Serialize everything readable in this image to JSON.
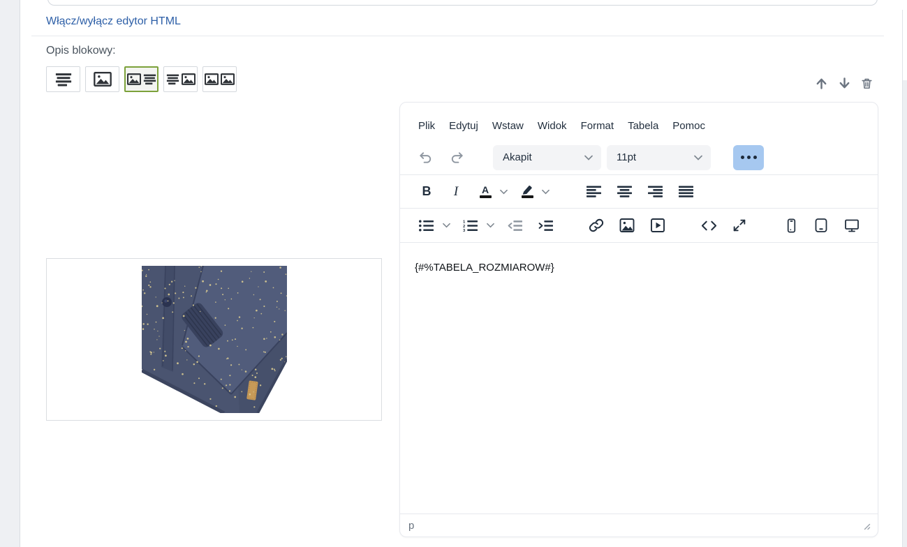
{
  "page": {
    "html_toggle_link": "Włącz/wyłącz edytor HTML",
    "block_label": "Opis blokowy:"
  },
  "colors": {
    "link_blue": "#2d5fa7",
    "selected_layout_green": "#7ca13a",
    "more_button_blue": "#a6c8f0",
    "toolbar_icon": "#222f3e",
    "jacket_navy": "#4a5470",
    "jacket_tag_tan": "#c79a58",
    "jacket_dots_gold": "#d9ca92"
  },
  "layout_picker": {
    "options": [
      {
        "id": "text-only",
        "icon": "text-lines-icon",
        "selected": false
      },
      {
        "id": "image-only",
        "icon": "image-icon",
        "selected": false
      },
      {
        "id": "image-text",
        "icon": "image-text-icon",
        "selected": true
      },
      {
        "id": "text-image",
        "icon": "text-image-icon",
        "selected": false
      },
      {
        "id": "image-image",
        "icon": "image-image-icon",
        "selected": false
      }
    ]
  },
  "block_actions": {
    "move_up_icon": "arrow-up-icon",
    "move_down_icon": "arrow-down-icon",
    "delete_icon": "trash-icon"
  },
  "editor": {
    "menu": [
      "Plik",
      "Edytuj",
      "Wstaw",
      "Widok",
      "Format",
      "Tabela",
      "Pomoc"
    ],
    "format_select_value": "Akapit",
    "fontsize_select_value": "11pt",
    "content_text": "{#%TABELA_ROZMIAROW#}",
    "status_element_path": "p"
  }
}
